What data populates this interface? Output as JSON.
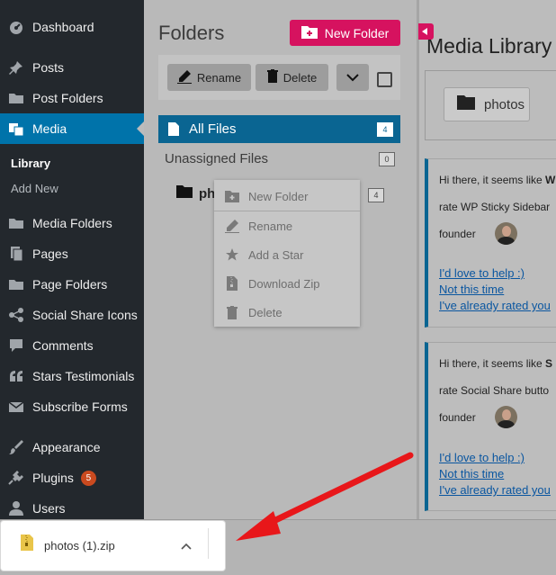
{
  "sidebar": {
    "items": [
      {
        "label": "Dashboard",
        "icon": "dashboard-icon"
      },
      {
        "label": "Posts",
        "icon": "pin-icon"
      },
      {
        "label": "Post Folders",
        "icon": "folder-open-icon"
      },
      {
        "label": "Media",
        "icon": "media-icon",
        "active": true
      },
      {
        "label": "Media Folders",
        "icon": "folder-open-icon"
      },
      {
        "label": "Pages",
        "icon": "pages-icon"
      },
      {
        "label": "Page Folders",
        "icon": "folder-open-icon"
      },
      {
        "label": "Social Share Icons",
        "icon": "share-icon"
      },
      {
        "label": "Comments",
        "icon": "comment-icon"
      },
      {
        "label": "Stars Testimonials",
        "icon": "quote-icon"
      },
      {
        "label": "Subscribe Forms",
        "icon": "mail-icon"
      },
      {
        "label": "Appearance",
        "icon": "brush-icon"
      },
      {
        "label": "Plugins",
        "icon": "plug-icon",
        "badge": "5"
      },
      {
        "label": "Users",
        "icon": "user-icon"
      }
    ],
    "submenu": [
      {
        "label": "Library",
        "current": true
      },
      {
        "label": "Add New"
      }
    ]
  },
  "folders": {
    "title": "Folders",
    "new_folder_label": "New Folder",
    "rename_label": "Rename",
    "delete_label": "Delete",
    "all_files_label": "All Files",
    "all_files_count": "4",
    "unassigned_label": "Unassigned Files",
    "unassigned_count": "0",
    "photos_label": "photos",
    "photos_count": "4"
  },
  "context_menu": {
    "items": [
      {
        "label": "New Folder",
        "icon": "folder-plus-icon"
      },
      {
        "label": "Rename",
        "icon": "pencil-icon"
      },
      {
        "label": "Add a Star",
        "icon": "star-icon"
      },
      {
        "label": "Download Zip",
        "icon": "zip-icon"
      },
      {
        "label": "Delete",
        "icon": "trash-icon"
      }
    ]
  },
  "media": {
    "title": "Media Library",
    "folder_chip_label": "photos",
    "notices": [
      {
        "line1_prefix": "Hi there, it seems like ",
        "line1_bold": "W",
        "line2": "rate WP Sticky Sidebar",
        "line3": "founder",
        "link1": "I'd love to help :)",
        "link2": "Not this time",
        "link3": "I've already rated you"
      },
      {
        "line1_prefix": "Hi there, it seems like ",
        "line1_bold": "S",
        "line2": "rate Social Share butto",
        "line3": "founder",
        "link1": "I'd love to help :)",
        "link2": "Not this time",
        "link3": "I've already rated you"
      }
    ]
  },
  "download_bar": {
    "file_name": "photos (1).zip"
  },
  "colors": {
    "sidebar_bg": "#23282d",
    "active_blue": "#0073aa",
    "accent_pink": "#d6125f",
    "arrow_red": "#e8171a"
  }
}
